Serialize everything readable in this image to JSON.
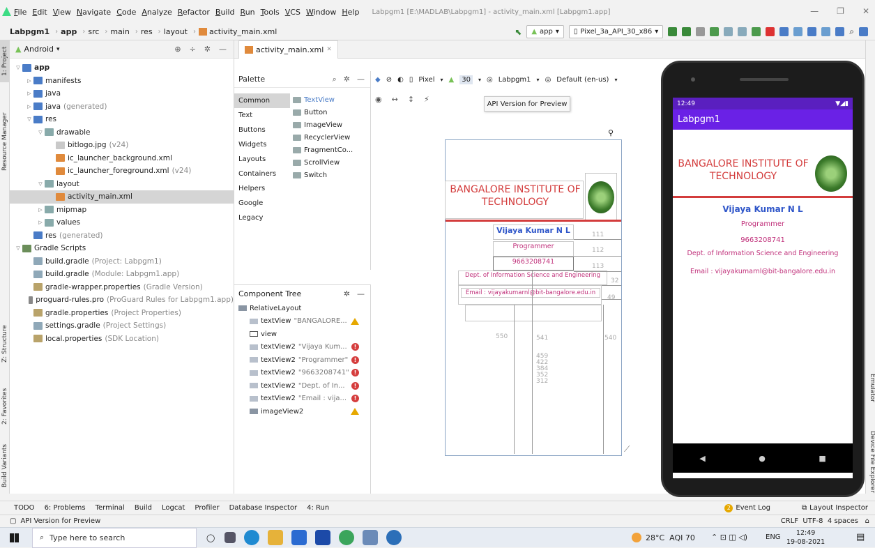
{
  "menu": {
    "items": [
      "File",
      "Edit",
      "View",
      "Navigate",
      "Code",
      "Analyze",
      "Refactor",
      "Build",
      "Run",
      "Tools",
      "VCS",
      "Window",
      "Help"
    ],
    "window_title": "Labpgm1 [E:\\MADLAB\\Labpgm1] - activity_main.xml [Labpgm1.app]"
  },
  "breadcrumb": [
    "Labpgm1",
    "app",
    "src",
    "main",
    "res",
    "layout",
    "activity_main.xml"
  ],
  "toolbar": {
    "module": "app",
    "device": "Pixel_3a_API_30_x86"
  },
  "sidetabs": {
    "left": [
      "1: Project",
      "Resource Manager",
      "Z: Structure",
      "2: Favorites",
      "Build Variants"
    ],
    "right": [
      "Emulator",
      "Device File Explorer"
    ]
  },
  "project": {
    "view": "Android",
    "tree": [
      {
        "label": "app",
        "dim": "",
        "depth": 0,
        "arrow": "v",
        "color": "#4a7cc7",
        "sel": false,
        "bold": true
      },
      {
        "label": "manifests",
        "dim": "",
        "depth": 1,
        "arrow": ">",
        "color": "#4a7cc7",
        "sel": false,
        "bold": false
      },
      {
        "label": "java",
        "dim": "",
        "depth": 1,
        "arrow": ">",
        "color": "#4a7cc7",
        "sel": false,
        "bold": false
      },
      {
        "label": "java",
        "dim": "(generated)",
        "depth": 1,
        "arrow": ">",
        "color": "#4a7cc7",
        "sel": false,
        "bold": false
      },
      {
        "label": "res",
        "dim": "",
        "depth": 1,
        "arrow": "v",
        "color": "#4a7cc7",
        "sel": false,
        "bold": false
      },
      {
        "label": "drawable",
        "dim": "",
        "depth": 2,
        "arrow": "v",
        "color": "#8aa",
        "sel": false,
        "bold": false
      },
      {
        "label": "bitlogo.jpg",
        "dim": "(v24)",
        "depth": 3,
        "arrow": "",
        "color": "#c9c9c9",
        "sel": false,
        "bold": false
      },
      {
        "label": "ic_launcher_background.xml",
        "dim": "",
        "depth": 3,
        "arrow": "",
        "color": "#e08a3c",
        "sel": false,
        "bold": false
      },
      {
        "label": "ic_launcher_foreground.xml",
        "dim": "(v24)",
        "depth": 3,
        "arrow": "",
        "color": "#e08a3c",
        "sel": false,
        "bold": false
      },
      {
        "label": "layout",
        "dim": "",
        "depth": 2,
        "arrow": "v",
        "color": "#8aa",
        "sel": false,
        "bold": false
      },
      {
        "label": "activity_main.xml",
        "dim": "",
        "depth": 3,
        "arrow": "",
        "color": "#e08a3c",
        "sel": true,
        "bold": false
      },
      {
        "label": "mipmap",
        "dim": "",
        "depth": 2,
        "arrow": ">",
        "color": "#8aa",
        "sel": false,
        "bold": false
      },
      {
        "label": "values",
        "dim": "",
        "depth": 2,
        "arrow": ">",
        "color": "#8aa",
        "sel": false,
        "bold": false
      },
      {
        "label": "res",
        "dim": "(generated)",
        "depth": 1,
        "arrow": "",
        "color": "#4a7cc7",
        "sel": false,
        "bold": false
      },
      {
        "label": "Gradle Scripts",
        "dim": "",
        "depth": 0,
        "arrow": "v",
        "color": "#6b8e5a",
        "sel": false,
        "bold": false
      },
      {
        "label": "build.gradle",
        "dim": "(Project: Labpgm1)",
        "depth": 1,
        "arrow": "",
        "color": "#8fa8b8",
        "sel": false,
        "bold": false
      },
      {
        "label": "build.gradle",
        "dim": "(Module: Labpgm1.app)",
        "depth": 1,
        "arrow": "",
        "color": "#8fa8b8",
        "sel": false,
        "bold": false
      },
      {
        "label": "gradle-wrapper.properties",
        "dim": "(Gradle Version)",
        "depth": 1,
        "arrow": "",
        "color": "#b9a36a",
        "sel": false,
        "bold": false
      },
      {
        "label": "proguard-rules.pro",
        "dim": "(ProGuard Rules for Labpgm1.app)",
        "depth": 1,
        "arrow": "",
        "color": "#888",
        "sel": false,
        "bold": false
      },
      {
        "label": "gradle.properties",
        "dim": "(Project Properties)",
        "depth": 1,
        "arrow": "",
        "color": "#b9a36a",
        "sel": false,
        "bold": false
      },
      {
        "label": "settings.gradle",
        "dim": "(Project Settings)",
        "depth": 1,
        "arrow": "",
        "color": "#8fa8b8",
        "sel": false,
        "bold": false
      },
      {
        "label": "local.properties",
        "dim": "(SDK Location)",
        "depth": 1,
        "arrow": "",
        "color": "#b9a36a",
        "sel": false,
        "bold": false
      }
    ]
  },
  "editor": {
    "tab": "activity_main.xml"
  },
  "palette": {
    "title": "Palette",
    "categories": [
      "Common",
      "Text",
      "Buttons",
      "Widgets",
      "Layouts",
      "Containers",
      "Helpers",
      "Google",
      "Legacy"
    ],
    "items": [
      "TextView",
      "Button",
      "ImageView",
      "RecyclerView",
      "FragmentCo...",
      "ScrollView",
      "Switch"
    ]
  },
  "design": {
    "device": "Pixel",
    "api": "30",
    "theme": "Labpgm1",
    "locale": "Default (en-us)",
    "tooltip": "API Version for Preview"
  },
  "component_tree": {
    "title": "Component Tree",
    "root": "RelativeLayout",
    "items": [
      {
        "name": "textView",
        "text": "\"BANGALORE...",
        "status": "warn"
      },
      {
        "name": "view",
        "text": "",
        "status": ""
      },
      {
        "name": "textView2",
        "text": "\"Vijaya Kum...",
        "status": "err"
      },
      {
        "name": "textView2",
        "text": "\"Programmer\"",
        "status": "err"
      },
      {
        "name": "textView2",
        "text": "\"9663208741\"",
        "status": "err"
      },
      {
        "name": "textView2",
        "text": "\"Dept. of In...",
        "status": "err"
      },
      {
        "name": "textView2",
        "text": "\"Email : vija...",
        "status": "err"
      },
      {
        "name": "imageView2",
        "text": "",
        "status": "warn"
      }
    ]
  },
  "blueprint": {
    "college": "BANGALORE INSTITUTE OF TECHNOLOGY",
    "name": "Vijaya Kumar N L",
    "role": "Programmer",
    "phone": "9663208741",
    "dept": "Dept. of Information Science and Engineering",
    "email": "Email : vijayakumarnl@bit-bangalore.edu.in",
    "numbers": [
      "111",
      "112",
      "113",
      "32",
      "49",
      "550",
      "541",
      "540",
      "459",
      "422",
      "384",
      "352",
      "312"
    ]
  },
  "phone": {
    "time": "12:49",
    "app_title": "Labpgm1",
    "college": "BANGALORE INSTITUTE OF TECHNOLOGY",
    "name": "Vijaya Kumar N L",
    "role": "Programmer",
    "phone": "9663208741",
    "dept": "Dept. of Information Science and Engineering",
    "email": "Email : vijayakumarnl@bit-bangalore.edu.in"
  },
  "bottom": {
    "tabs": [
      "TODO",
      "6: Problems",
      "Terminal",
      "Build",
      "Logcat",
      "Profiler",
      "Database Inspector",
      "4: Run"
    ],
    "event_log": "Event Log",
    "event_count": "2",
    "layout_inspector": "Layout Inspector"
  },
  "statusline": {
    "text": "API Version for Preview",
    "encoding": "CRLF  UTF-8  4 spaces"
  },
  "taskbar": {
    "search": "Type here to search",
    "weather": "28°C  AQI 70",
    "lang": "ENG",
    "time": "12:49",
    "date": "19-08-2021"
  },
  "colors": {
    "accent": "#6a21e6",
    "college_red": "#d33c3c",
    "name_blue": "#2f56c9",
    "pink": "#c0307a",
    "android_green": "#78c257"
  }
}
